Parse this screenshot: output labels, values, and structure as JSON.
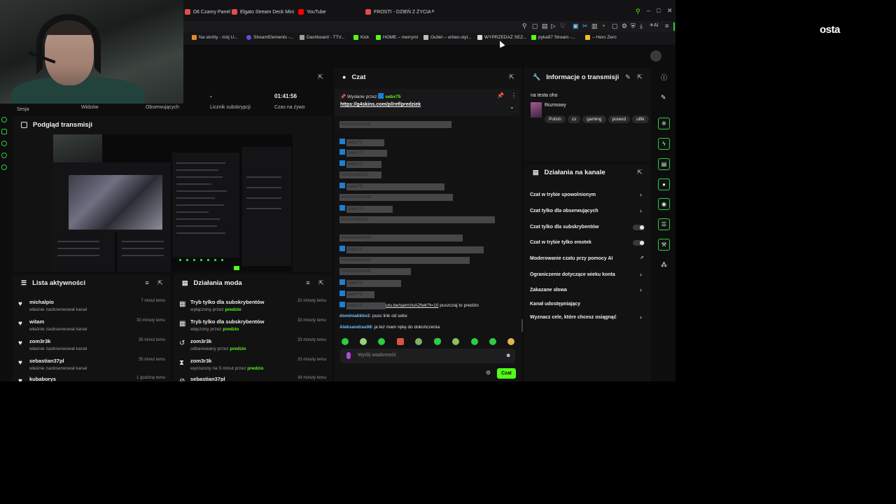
{
  "watermark": "osta",
  "tabs": [
    {
      "label": "D6 Czarny Panel",
      "color": "#e44c4c"
    },
    {
      "label": "Elgato Stream Deck Mini",
      "color": "#e44c4c"
    },
    {
      "label": "YouTube",
      "color": "#ff0000"
    },
    {
      "label": "FROSTI - DZIEŃ Z ŻYCIA",
      "color": "#e44c4c"
    }
  ],
  "bookmarks": [
    {
      "label": "Na skróty - mój U...",
      "color": "#e48a2b"
    },
    {
      "label": "StreamElements -...",
      "color": "#5b4fe0"
    },
    {
      "label": "Dashboard - TTV...",
      "color": "#a0a0a0"
    },
    {
      "label": "Kick",
      "color": "#53fc18"
    },
    {
      "label": "HOME – merrymi",
      "color": "#53fc18"
    },
    {
      "label": "Outlet – urban-styl...",
      "color": "#bdbdbd"
    },
    {
      "label": "WYPRZEDAŻ SEZ...",
      "color": "#dddddd"
    },
    {
      "label": "pyka97 Stream -...",
      "color": "#53fc18"
    },
    {
      "label": "– Hero Zero",
      "color": "#f0c020"
    }
  ],
  "stats": {
    "items": [
      {
        "label": "Sesja",
        "value": ""
      },
      {
        "label": "Widzów",
        "value": ""
      },
      {
        "label": "Obserwujących",
        "value": ""
      },
      {
        "label": "Licznik subskrypcji",
        "value": "-"
      },
      {
        "label": "Czas na żywo",
        "value": "01:41:56"
      }
    ]
  },
  "preview": {
    "title": "Podgląd transmisji"
  },
  "activity": {
    "title": "Lista aktywności",
    "items": [
      {
        "name": "michalpio",
        "sub": "właśnie zaobserwował kanał",
        "time": "7 minut temu"
      },
      {
        "name": "witam",
        "sub": "właśnie zaobserwował kanał",
        "time": "33 minuty temu"
      },
      {
        "name": "zom3r3k",
        "sub": "właśnie zaobserwował kanał",
        "time": "35 minut temu"
      },
      {
        "name": "sebastian37pl",
        "sub": "właśnie zaobserwował kanał",
        "time": "35 minut temu"
      },
      {
        "name": "kubaborys",
        "sub": "",
        "time": "1 godzinę temu"
      }
    ]
  },
  "modactions": {
    "title": "Działania moda",
    "items": [
      {
        "name": "Tryb tylko dla subskrybentów",
        "sub": "wyłączony przez",
        "by": "predzio",
        "time": "32 minuty temu",
        "icon": "▦"
      },
      {
        "name": "Tryb tylko dla subskrybentów",
        "sub": "włączony przez",
        "by": "predzio",
        "time": "33 minuty temu",
        "icon": "▦"
      },
      {
        "name": "zom3r3k",
        "sub": "odbanowany przez",
        "by": "predzio",
        "time": "33 minuty temu",
        "icon": "↺"
      },
      {
        "name": "zom3r3k",
        "sub": "wyciszony na 5 minut przez",
        "by": "predzio",
        "time": "33 minuty temu",
        "icon": "⧗"
      },
      {
        "name": "sebastian37pl",
        "sub": "",
        "by": "",
        "time": "34 minuty temu",
        "icon": "⊘"
      }
    ]
  },
  "chat": {
    "title": "Czat",
    "pinned_by_label": "Wysłane przez",
    "pinned_by": "sebx75",
    "pinned_link": "https://g4skins.com/pl/ref/predziek",
    "messages": [
      {
        "name": "Aleksandras08",
        "text": "...",
        "hidden": true
      },
      {
        "name": "",
        "text": "",
        "hidden": true
      },
      {
        "name": "sebx75",
        "text": "",
        "hidden": true
      },
      {
        "name": "sebx75",
        "text": "",
        "hidden": true
      },
      {
        "name": "sebx75",
        "text": "",
        "hidden": true
      },
      {
        "name": "dominiakkbv2",
        "text": "",
        "hidden": true
      },
      {
        "name": "sebx75",
        "text": "",
        "hidden": true
      },
      {
        "name": "Aleksandras08",
        "text": "",
        "hidden": true
      },
      {
        "name": "sebx75",
        "text": "",
        "hidden": true
      },
      {
        "name": "dominiakkbv2",
        "text": "",
        "hidden": true
      },
      {
        "name": "Aleksandras08",
        "text": "",
        "hidden": true
      },
      {
        "name": "sebx75",
        "text": "",
        "hidden": true
      },
      {
        "name": "Aleksandras08",
        "text": "",
        "hidden": true
      },
      {
        "name": "Aleksandras08",
        "text": "",
        "hidden": true
      },
      {
        "name": "sebx75",
        "text": "",
        "hidden": true
      },
      {
        "name": "sebx75",
        "text": "",
        "hidden": true
      }
    ],
    "partial_msg": {
      "name": "sebx75",
      "link": "utu.be/sjemVuA2fwk?t=10",
      "text": "puszczaj to predzio"
    },
    "msg1": {
      "name": "dominiakkbv2",
      "text": ": pusc link od sebx"
    },
    "msg2": {
      "name": "Aleksandras08",
      "text": ": ja też mam rękę do dokończenia"
    },
    "input_placeholder": "Wyślij wiadomość",
    "send_label": "Czat"
  },
  "info": {
    "title": "Informacje o transmisji",
    "stream_title": "na testa oho",
    "category": "Rozmowy",
    "tags": [
      "Polish",
      "cs",
      "gaming",
      "poland",
      "ulfik"
    ]
  },
  "channel_actions": {
    "title": "Działania na kanale",
    "items": [
      {
        "label": "Czat w trybie spowolnionym",
        "control": "chevron"
      },
      {
        "label": "Czat tylko dla obserwujących",
        "control": "chevron"
      },
      {
        "label": "Czat tylko dla subskrybentów",
        "control": "toggle"
      },
      {
        "label": "Czat w trybie tylko emotek",
        "control": "toggle"
      },
      {
        "label": "Moderowanie czatu przy pomocy AI",
        "control": "external"
      },
      {
        "label": "Ograniczenie dotyczące wieku konta",
        "control": "chevron"
      },
      {
        "label": "Zakazane słowa",
        "control": "chevron"
      },
      {
        "label": "Kanał udostępniający",
        "control": "none"
      },
      {
        "label": "Wyznacz cele, które chcesz osiągnąć",
        "control": "chevron"
      }
    ]
  }
}
